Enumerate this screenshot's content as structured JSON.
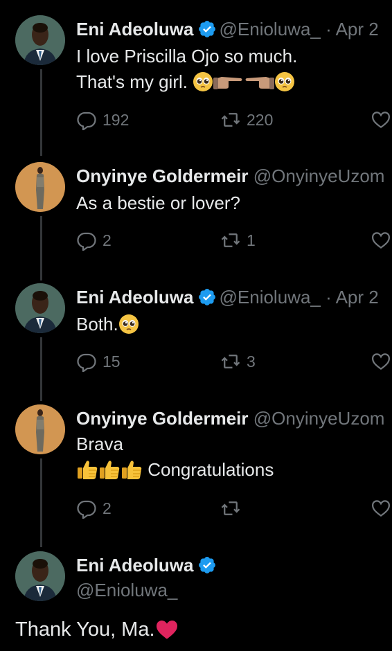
{
  "tweets": [
    {
      "name": "Eni Adeoluwa",
      "verified": true,
      "handle": "@Enioluwa_",
      "separator": "·",
      "date": "Apr 2",
      "lines": [
        "I love Priscilla Ojo so much.",
        "That's my girl."
      ],
      "emojis": [
        "pleading-face",
        "point-right",
        "point-left",
        "pleading-face"
      ],
      "replies": "192",
      "retweets": "220"
    },
    {
      "name": "Onyinye Goldermeir",
      "verified": false,
      "handle": "@OnyinyeUzom",
      "lines": [
        "As a bestie or lover?"
      ],
      "replies": "2",
      "retweets": "1"
    },
    {
      "name": "Eni Adeoluwa",
      "verified": true,
      "handle": "@Enioluwa_",
      "separator": "·",
      "date": "Apr 2",
      "lines": [
        "Both."
      ],
      "emojis": [
        "pleading-face"
      ],
      "replies": "15",
      "retweets": "3"
    },
    {
      "name": "Onyinye Goldermeir",
      "verified": false,
      "handle": "@OnyinyeUzom",
      "lines": [
        "Brava",
        "Congratulations"
      ],
      "emojis": [
        "thumbs-up",
        "thumbs-up",
        "thumbs-up"
      ],
      "replies": "2",
      "retweets": ""
    }
  ],
  "main_tweet": {
    "name": "Eni Adeoluwa",
    "verified": true,
    "handle": "@Enioluwa_",
    "text": "Thank You, Ma.",
    "emoji": "red-heart"
  },
  "colors": {
    "background": "#000000",
    "text": "#e7e9ea",
    "muted": "#71767b",
    "verified": "#1d9bf0",
    "thread_line": "#333639",
    "heart": "#e0245e"
  }
}
